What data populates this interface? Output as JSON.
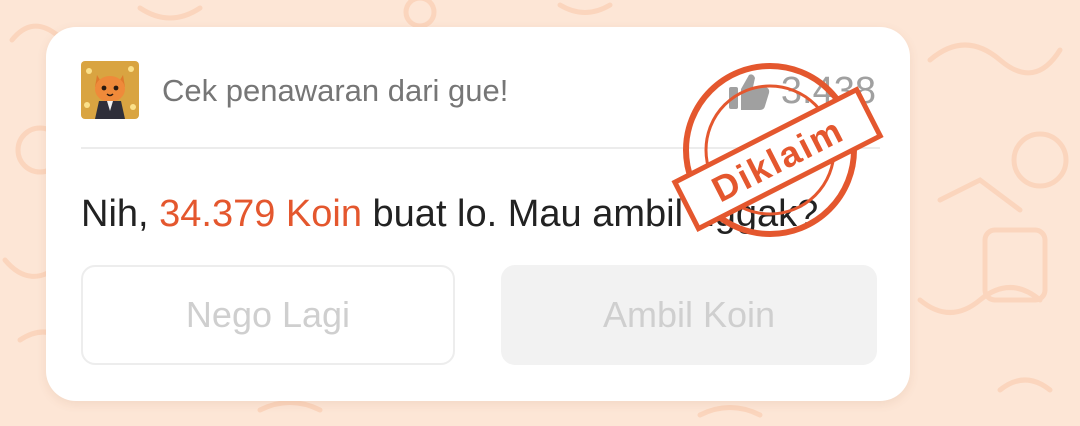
{
  "card": {
    "header_text": "Cek penawaran dari gue!",
    "like_count": "3.438",
    "message": {
      "prefix": "Nih, ",
      "amount": "34.379 Koin",
      "suffix": " buat lo. Mau ambil nggak?"
    },
    "buttons": {
      "nego_label": "Nego Lagi",
      "ambil_label": "Ambil Koin"
    }
  },
  "stamp": {
    "label": "Diklaim",
    "color": "#e4572e"
  },
  "colors": {
    "accent": "#e4572e",
    "background": "#fde6d6"
  },
  "icons": {
    "avatar": "cat-avatar",
    "like": "thumbs-up-icon"
  }
}
